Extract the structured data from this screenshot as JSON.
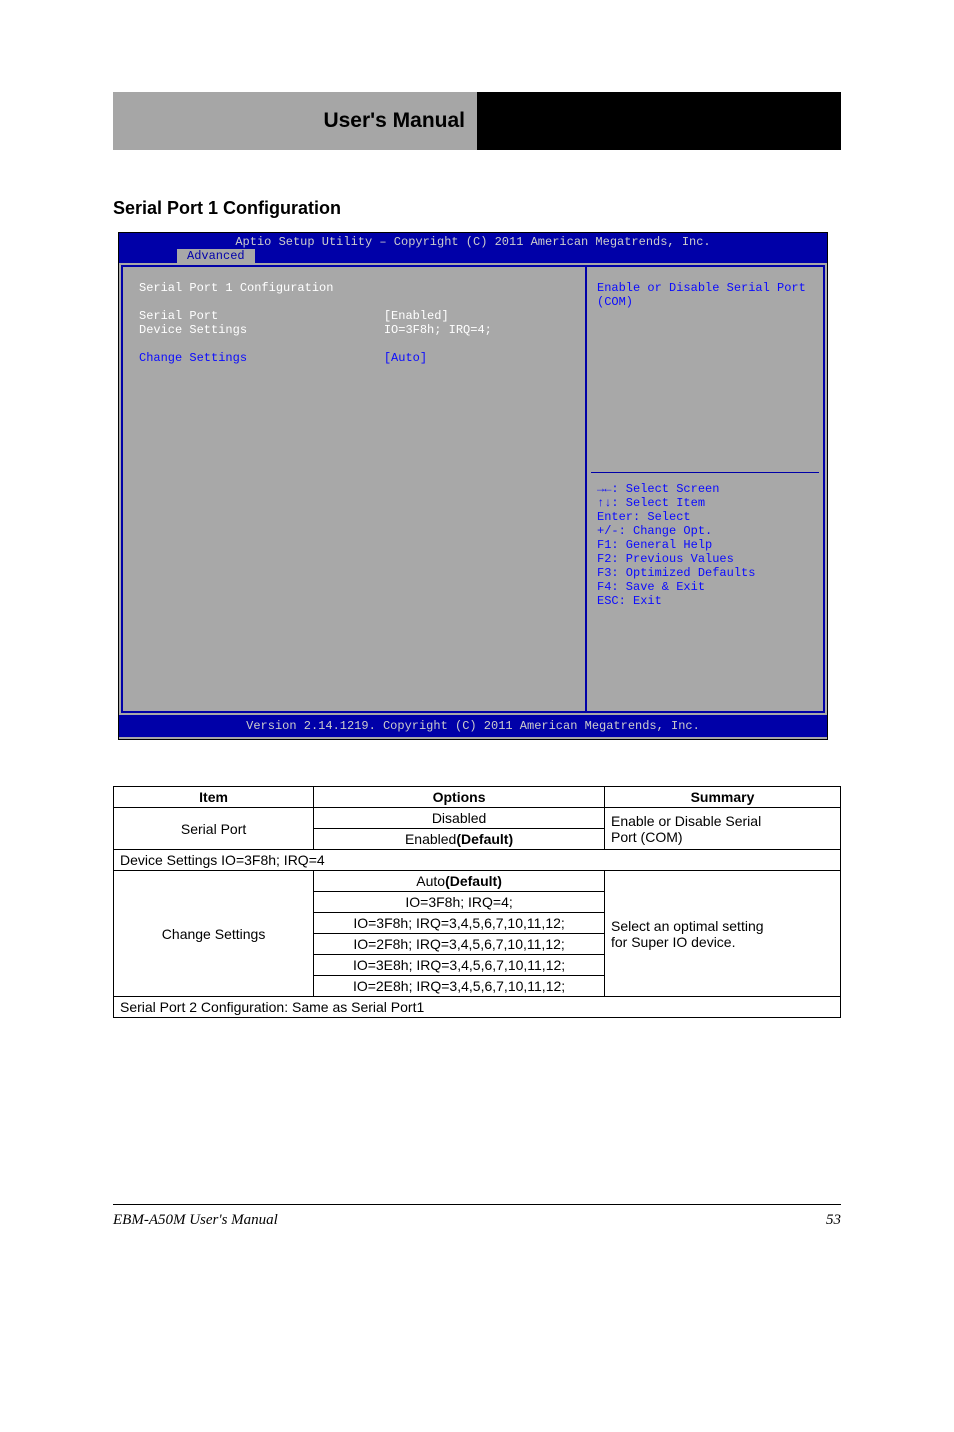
{
  "banner": {
    "left": "User's Manual",
    "right": ""
  },
  "section_heading": "Serial Port 1 Configuration",
  "bios": {
    "title": "Aptio Setup Utility – Copyright (C) 2011 American Megatrends, Inc.",
    "tab": "Advanced",
    "heading": "Serial Port 1 Configuration",
    "rows": [
      {
        "label": "Serial Port",
        "value": "[Enabled]",
        "color": "white"
      },
      {
        "label": "Device Settings",
        "value": "IO=3F8h; IRQ=4;",
        "color": "white"
      },
      {
        "label": "",
        "value": "",
        "color": "white"
      },
      {
        "label": "Change Settings",
        "value": "[Auto]",
        "color": "blue"
      }
    ],
    "help_top": "Enable or Disable Serial Port\n(COM)",
    "nav": [
      "→←: Select Screen",
      "↑↓: Select Item",
      "Enter: Select",
      "+/-: Change Opt.",
      "F1: General Help",
      "F2: Previous Values",
      "F3: Optimized Defaults",
      "F4: Save & Exit",
      "ESC: Exit"
    ],
    "footer": "Version 2.14.1219. Copyright (C) 2011 American Megatrends, Inc."
  },
  "table": {
    "headers": [
      "Item",
      "Options",
      "Summary"
    ],
    "groups": [
      {
        "item": "Serial Port",
        "options": [
          "Disabled",
          "Enabled(Default)"
        ],
        "summary": "Enable or Disable Serial\nPort (COM)"
      },
      {
        "subheader": "Device Settings IO=3F8h; IRQ=4"
      },
      {
        "item": "Change Settings",
        "options": [
          "Auto(Default)",
          "IO=3F8h; IRQ=4;",
          "IO=3F8h; IRQ=3,4,5,6,7,10,11,12;",
          "IO=2F8h; IRQ=3,4,5,6,7,10,11,12;",
          "IO=3E8h; IRQ=3,4,5,6,7,10,11,12;",
          "IO=2E8h; IRQ=3,4,5,6,7,10,11,12;"
        ],
        "summary": "Select an optimal setting\nfor Super IO device."
      },
      {
        "subheader": "Serial Port 2 Configuration: Same as Serial Port1"
      }
    ]
  },
  "footer": {
    "left": "EBM-A50M User's Manual",
    "right": "53"
  }
}
